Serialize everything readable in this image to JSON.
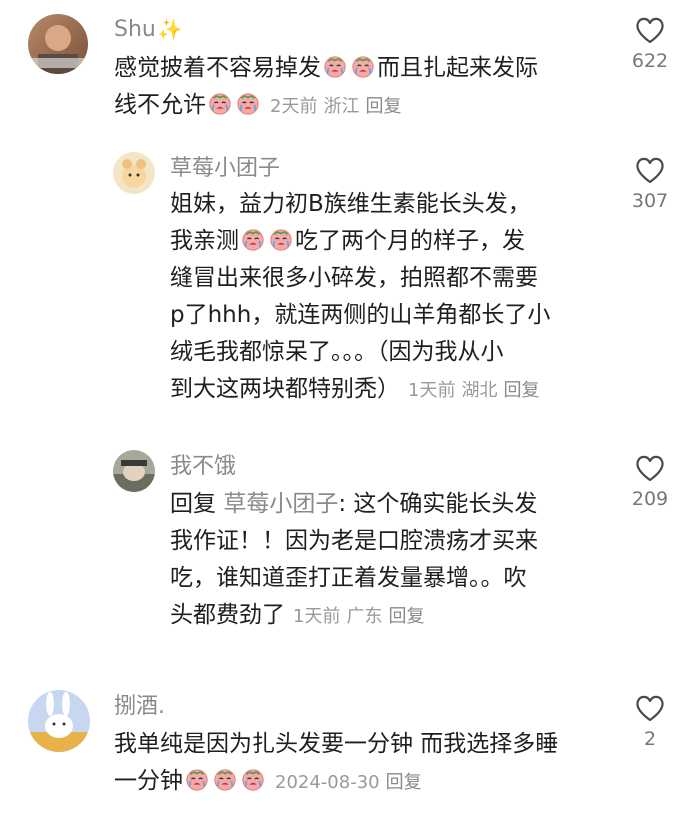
{
  "comments": [
    {
      "username": "Shu",
      "username_suffix": "✨",
      "text_1": "感觉披着不容易掉发",
      "text_2": "而且扎起来发际",
      "text_3": "线不允许",
      "time": "2天前",
      "location": "浙江",
      "reply_label": "回复",
      "likes": "622"
    },
    {
      "username": "草莓小团子",
      "lines": [
        "姐妹，益力初B族维生素能长头发，"
      ],
      "text_pre_emoji": "我亲测",
      "text_post_emoji": "吃了两个月的样子，发",
      "lines_after": [
        "缝冒出来很多小碎发，拍照都不需要",
        "p了hhh，就连两侧的山羊角都长了小",
        "绒毛我都惊呆了。。。（因为我从小"
      ],
      "last_line": "到大这两块都特别秃）",
      "time": "1天前",
      "location": "湖北",
      "reply_label": "回复",
      "likes": "307"
    },
    {
      "username": "我不饿",
      "reply_prefix": "回复",
      "reply_target": "草莓小团子",
      "first_line_rest": ": 这个确实能长头发",
      "lines": [
        "我作证！！因为老是口腔溃疡才买来",
        "吃，谁知道歪打正着发量暴增。。吹"
      ],
      "last_line": "头都费劲了",
      "time": "1天前",
      "location": "广东",
      "reply_label": "回复",
      "likes": "209"
    },
    {
      "username": "捌酒.",
      "line_1": "我单纯是因为扎头发要一分钟 而我选择多睡",
      "line_2": "一分钟",
      "time": "2024-08-30",
      "reply_label": "回复",
      "likes": "2"
    }
  ],
  "colors": {
    "text": "#1f1f1f",
    "username": "#8a8a8a",
    "meta": "#9a9a9a",
    "heart_stroke": "#4a4a4a"
  },
  "icons": [
    "heart-outline-icon",
    "crying-emoji-icon",
    "sparkle-icon"
  ]
}
